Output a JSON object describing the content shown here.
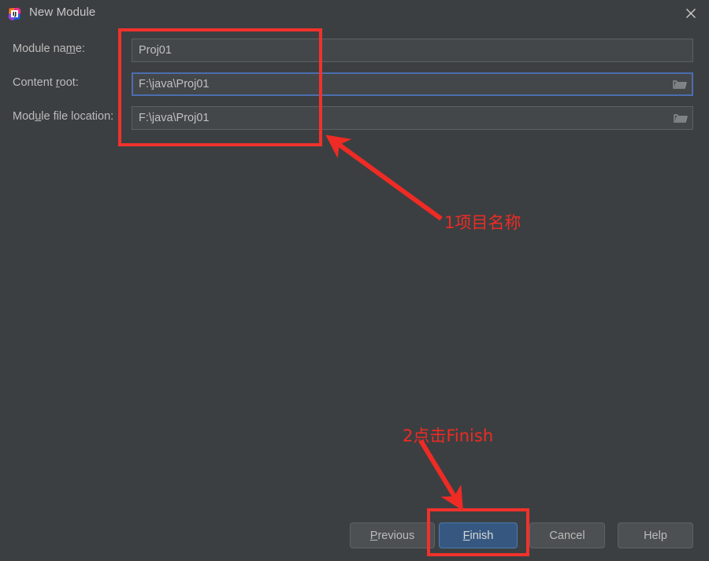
{
  "window": {
    "title": "New Module",
    "icon": "intellij-idea-logo-icon",
    "close_icon": "close-icon",
    "background_color": "#3c3f41"
  },
  "form": {
    "rows": [
      {
        "label_before": "Module na",
        "label_mnemonic": "m",
        "label_after": "e:",
        "value": "Proj01",
        "has_browse": false,
        "focused": false
      },
      {
        "label_before": "Content ",
        "label_mnemonic": "r",
        "label_after": "oot:",
        "value": "F:\\java\\Proj01",
        "has_browse": true,
        "browse_icon": "folder-browse-icon",
        "focused": true
      },
      {
        "label_before": "Mod",
        "label_mnemonic": "u",
        "label_after": "le file location:",
        "value": "F:\\java\\Proj01",
        "has_browse": true,
        "browse_icon": "folder-browse-icon",
        "focused": false
      }
    ]
  },
  "buttons": {
    "previous": {
      "before": "",
      "mnemonic": "P",
      "after": "revious"
    },
    "finish": {
      "before": "",
      "mnemonic": "F",
      "after": "inish"
    },
    "cancel": {
      "before": "Cancel",
      "mnemonic": "",
      "after": ""
    },
    "help": {
      "before": "Help",
      "mnemonic": "",
      "after": ""
    }
  },
  "annotations": {
    "color": "#ee2b24",
    "note_1": "1项目名称",
    "note_2": "2点击Finish"
  }
}
